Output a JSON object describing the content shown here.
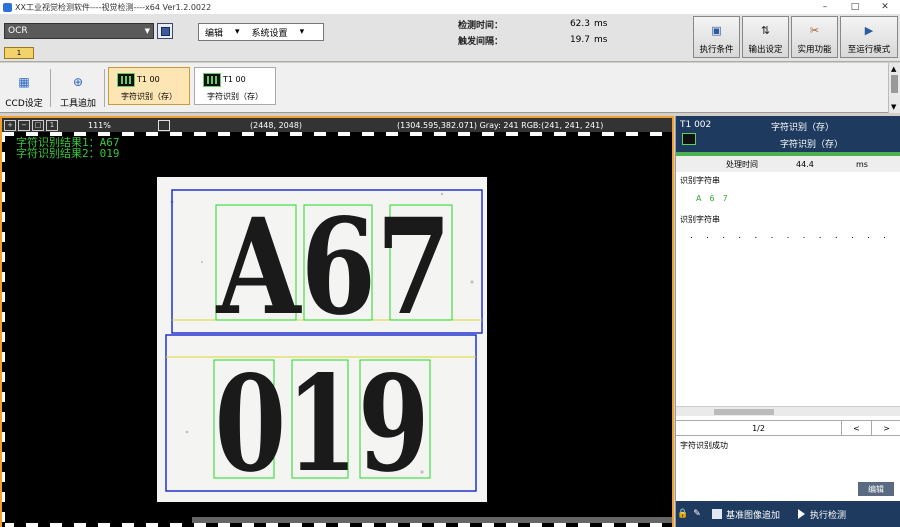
{
  "window": {
    "title": "XX工业视觉检测软件----视觉检测----x64 Ver1.2.0022"
  },
  "header": {
    "camera_select": "OCR",
    "tab_tag": "1",
    "menu": [
      "编辑",
      "系统设置"
    ],
    "stats": {
      "detect_time_label": "检测时间：",
      "detect_time_value": "62.3",
      "trigger_interval_label": "触发间隔：",
      "trigger_interval_value": "19.7",
      "unit": "ms"
    },
    "buttons": [
      {
        "label": "执行条件",
        "icon": "play-doc-icon"
      },
      {
        "label": "输出设定",
        "icon": "arrows-icon"
      },
      {
        "label": "实用功能",
        "icon": "tools-icon"
      },
      {
        "label": "至运行模式",
        "icon": "run-mode-icon"
      }
    ]
  },
  "toolbar": {
    "ccd_label": "CCD设定",
    "tool_add_label": "工具追加",
    "steps": [
      {
        "id": "T1 00",
        "name": "字符识别（存）",
        "active": true
      },
      {
        "id": "T1 00",
        "name": "字符识别（存）",
        "active": false
      }
    ]
  },
  "viewer": {
    "zoom": "111%",
    "image_size": "(2448, 2048)",
    "pixel_info": "(1304.595,382.071) Gray: 241  RGB:(241, 241, 241)",
    "result_line1": "字符识别结果1：A67",
    "result_line2": "字符识别结果2：019",
    "line1_text": "A67",
    "line2_text": "019"
  },
  "side_panel": {
    "tool_id": "T1 002",
    "tool_title": "字符识别（存）",
    "tool_subtitle": "字符识别（存）",
    "time_label": "处理时间",
    "time_value": "44.4",
    "time_unit": "ms",
    "section1_label": "识别字符串",
    "chars": [
      "A",
      "6",
      "7"
    ],
    "section2_label": "识别字符串",
    "dots": [
      ".",
      ".",
      ".",
      ".",
      ".",
      ".",
      ".",
      ".",
      ".",
      ".",
      ".",
      ".",
      "."
    ],
    "pager": "1/2",
    "prev": "<",
    "next": ">",
    "status": "字符识别成功",
    "edit_label": "编辑",
    "footer_add": "基准图像追加",
    "footer_run": "执行检测"
  }
}
